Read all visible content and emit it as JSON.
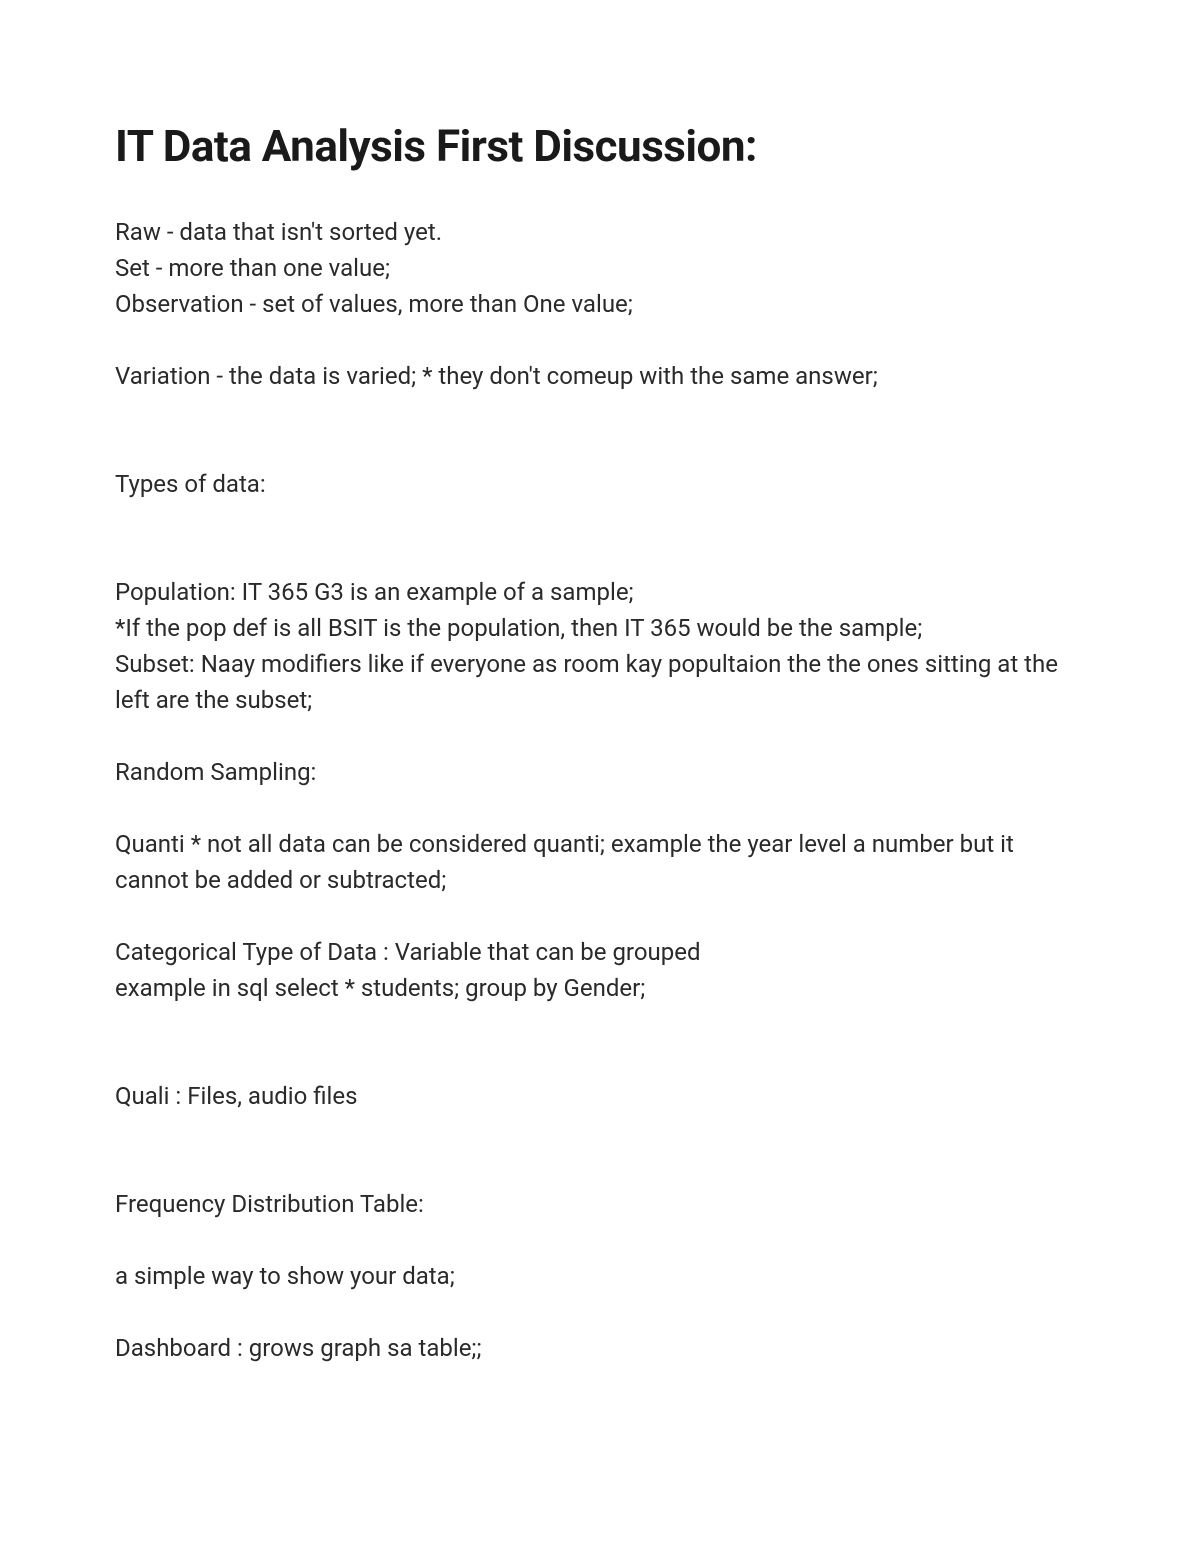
{
  "title": "IT Data Analysis First Discussion:",
  "lines": {
    "l1": "Raw - data that isn't sorted yet.",
    "l2": "Set - more than one value;",
    "l3": "Observation - set of values, more than One value;",
    "l4": "Variation - the data is varied; * they don't comeup with the same answer;",
    "l5": "Types of data:",
    "l6": "Population: IT 365 G3 is an example of a sample;",
    "l7": "*If the pop def is all BSIT is the population, then IT 365 would be the sample;",
    "l8": "Subset: Naay modifiers like if everyone as room kay popultaion the the ones sitting at the left are the subset;",
    "l9": "Random Sampling:",
    "l10": "Quanti * not all data can be considered quanti; example the year level a number but it cannot be added or subtracted;",
    "l11": "Categorical Type of Data : Variable that can be grouped",
    "l12": "example in sql select * students; group by Gender;",
    "l13": "Quali : Files, audio files",
    "l14": "Frequency Distribution Table:",
    "l15": "a simple way to show your data;",
    "l16": "Dashboard : grows graph sa table;;"
  }
}
